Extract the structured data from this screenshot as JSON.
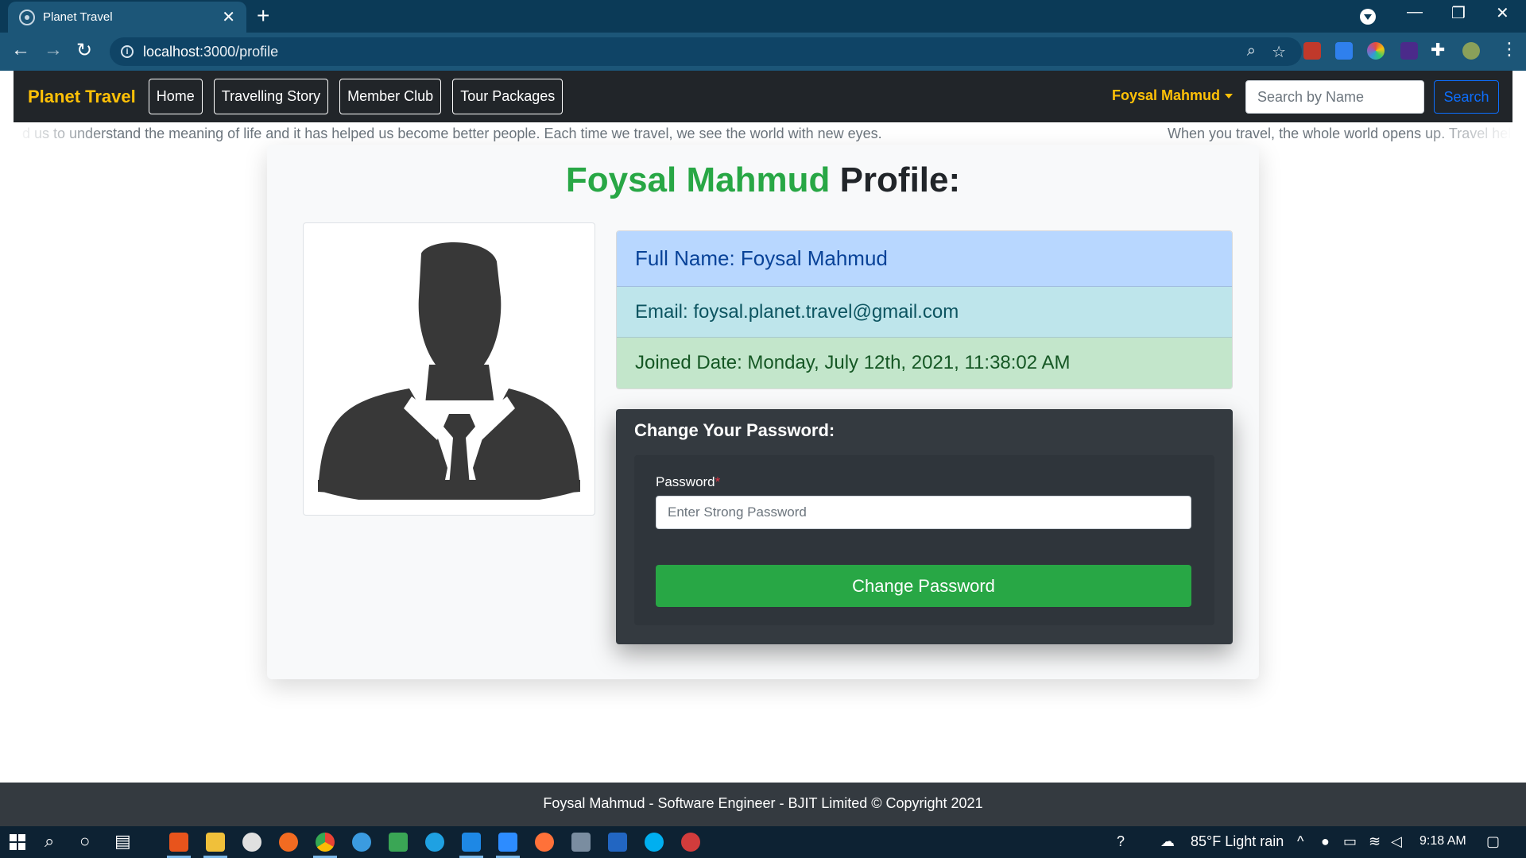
{
  "browser": {
    "tab_title": "Planet Travel",
    "tab_close": "✕",
    "new_tab": "+",
    "url_host": "localhost",
    "url_path": ":3000/profile"
  },
  "navbar": {
    "brand": "Planet Travel",
    "links": [
      {
        "label": "Home"
      },
      {
        "label": "Travelling Story"
      },
      {
        "label": "Member Club"
      },
      {
        "label": "Tour Packages"
      }
    ],
    "user": "Foysal Mahmud",
    "search_placeholder": "Search by Name",
    "search_button": "Search"
  },
  "marquee": {
    "text_left": "d us to understand the meaning of life and it has helped us become better people. Each time we travel, we see the world with new eyes.",
    "text_right": "When you travel, the whole world opens up. Travel hel"
  },
  "profile": {
    "heading_name": "Foysal Mahmud",
    "heading_suffix": " Profile:",
    "full_name": "Full Name: Foysal Mahmud",
    "email": "Email: foysal.planet.travel@gmail.com",
    "joined": "Joined Date:  Monday, July 12th, 2021, 11:38:02 AM"
  },
  "password_form": {
    "heading": "Change Your Password:",
    "label": "Password",
    "required_mark": "*",
    "placeholder": "Enter Strong Password",
    "button": "Change Password"
  },
  "footer": {
    "text": "Foysal Mahmud - Software Engineer - BJIT Limited © Copyright 2021"
  },
  "taskbar": {
    "weather": "85°F  Light rain",
    "time": "9:18 AM"
  },
  "colors": {
    "brand": "#ffc107",
    "accent_green": "#28a745",
    "navbar_bg": "#212529",
    "footer_bg": "#343a40"
  }
}
